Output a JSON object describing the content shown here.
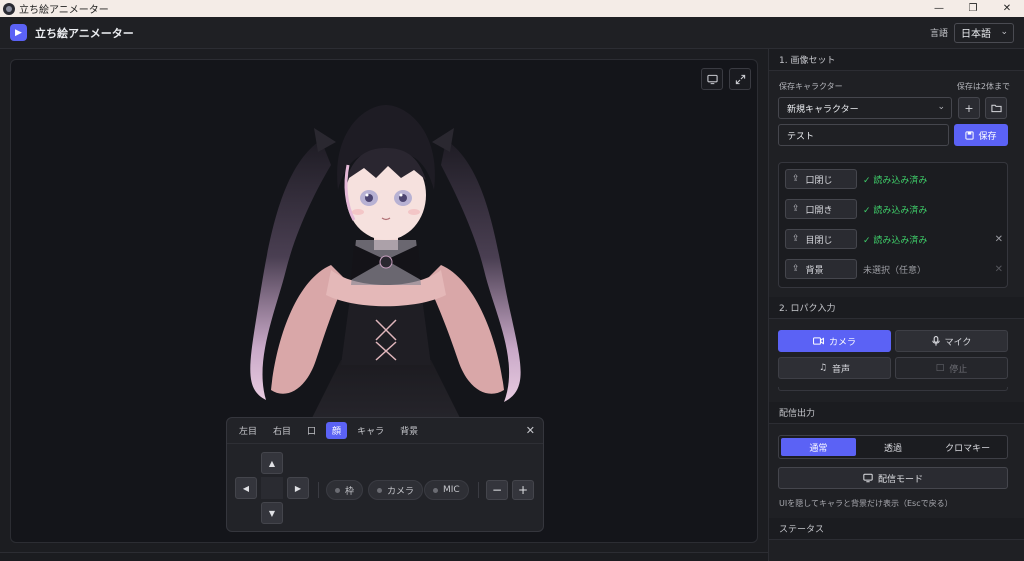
{
  "window": {
    "title": "立ち絵アニメーター",
    "minimize": "—",
    "restore": "❐",
    "close": "✕"
  },
  "header": {
    "app_name": "立ち絵アニメーター",
    "lang_label": "言語",
    "lang_value": "日本語"
  },
  "stage": {
    "monitor_icon": "monitor-icon",
    "expand_icon": "expand-icon"
  },
  "control_panel": {
    "tabs": [
      {
        "label": "左目"
      },
      {
        "label": "右目"
      },
      {
        "label": "口"
      },
      {
        "label": "顔",
        "active": true
      },
      {
        "label": "キャラ"
      },
      {
        "label": "背景"
      }
    ],
    "close": "✕",
    "toggles": {
      "frame": "枠",
      "camera": "カメラ",
      "mic": "MIC"
    },
    "zoom_out": "−",
    "zoom_in": "+"
  },
  "sidebar": {
    "image_set": {
      "title": "1. 画像セット",
      "saved_character_label": "保存キャラクター",
      "save_limit": "保存は2体まで",
      "character_select": "新規キャラクター",
      "name_input": "テスト",
      "save_button": "保存",
      "images": [
        {
          "label": "口閉じ",
          "status": "✓ 読み込み済み",
          "loaded": true,
          "removable": false
        },
        {
          "label": "口開き",
          "status": "✓ 読み込み済み",
          "loaded": true,
          "removable": false
        },
        {
          "label": "目閉じ",
          "status": "✓ 読み込み済み",
          "loaded": true,
          "removable": true
        },
        {
          "label": "背景",
          "status": "未選択（任意）",
          "loaded": false,
          "removable": false
        }
      ]
    },
    "lipsync": {
      "title": "2. ロパク入力",
      "camera": "カメラ",
      "mic": "マイク",
      "audio": "音声",
      "stop": "停止"
    },
    "output": {
      "title": "配信出力",
      "modes": [
        "通常",
        "透過",
        "クロマキー"
      ],
      "active_mode": "通常",
      "stream_mode_button": "配信モード",
      "hint": "UIを隠してキャラと背景だけ表示（Escで戻る）"
    },
    "status": {
      "title": "ステータス"
    }
  },
  "colors": {
    "accent": "#5b62f5",
    "success": "#3fcf6a",
    "background": "#1c1d21"
  }
}
